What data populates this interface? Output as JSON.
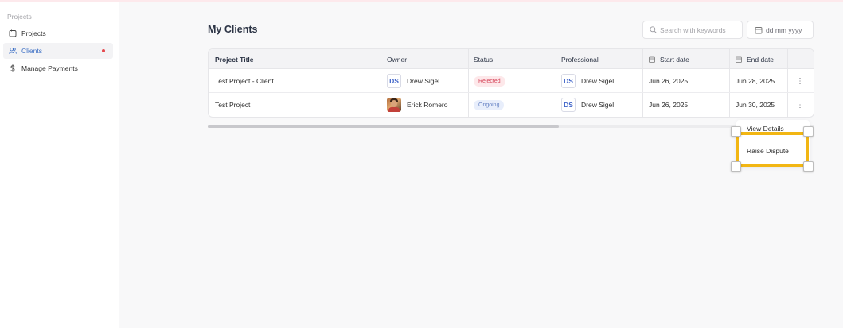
{
  "sidebar": {
    "section_label": "Projects",
    "items": [
      {
        "label": "Projects",
        "icon": "projects-icon"
      },
      {
        "label": "Clients",
        "icon": "users-icon",
        "active": true
      },
      {
        "label": "Manage Payments",
        "icon": "dollar-icon"
      }
    ]
  },
  "main": {
    "title": "My Clients",
    "search": {
      "placeholder": "Search with keywords"
    },
    "date_filter": {
      "label": "dd mm yyyy"
    }
  },
  "table": {
    "columns": [
      "Project Title",
      "Owner",
      "Status",
      "Professional",
      "Start date",
      "End date"
    ],
    "rows": [
      {
        "project_title": "Test Project - Client",
        "owner": "Drew Sigel",
        "owner_initials": "DS",
        "status": "Rejected",
        "professional": "Drew Sigel",
        "professional_initials": "DS",
        "start_date": "Jun 26, 2025",
        "end_date": "Jun 28, 2025"
      },
      {
        "project_title": "Test Project",
        "owner": "Erick Romero",
        "owner_initials": "",
        "status": "Ongoing",
        "professional": "Drew Sigel",
        "professional_initials": "DS",
        "start_date": "Jun 26, 2025",
        "end_date": "Jun 30, 2025"
      }
    ]
  },
  "row_menu": {
    "items": [
      "View Details",
      "Raise Dispute"
    ]
  },
  "colors": {
    "accent": "#3b6ec4",
    "highlight": "#f2b613",
    "rejected": "#d6455a",
    "ongoing": "#6783c4"
  }
}
